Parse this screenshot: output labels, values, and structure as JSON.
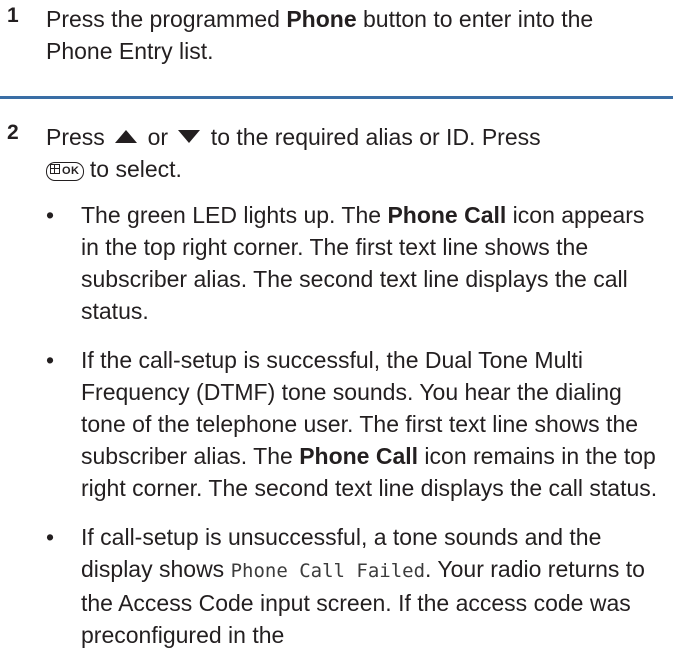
{
  "step1": {
    "number": "1",
    "text_before": "Press the programmed ",
    "bold": "Phone",
    "text_after": " button to enter into the Phone Entry list."
  },
  "step2": {
    "number": "2",
    "text_press": "Press ",
    "text_or": " or ",
    "text_after_arrows": " to the required alias or ID. Press",
    "ok_key_label": "OK",
    "text_select": " to select.",
    "bullets": [
      {
        "p1": "The green LED lights up. The ",
        "b1": "Phone Call",
        "p2": " icon appears in the top right corner. The first text line shows the subscriber alias. The second text line displays the call status."
      },
      {
        "p1": "If the call-setup is successful, the Dual Tone Multi Frequency (DTMF) tone sounds. You hear the dialing tone of the telephone user. The first text line shows the subscriber alias. The ",
        "b1": "Phone Call",
        "p2": " icon remains in the top right corner. The second text line displays the call status."
      },
      {
        "p1": "If call-setup is unsuccessful, a tone sounds and the display shows ",
        "mono": "Phone Call Failed",
        "p2": ". Your radio returns to the Access Code input screen. If the access code was preconfigured in the"
      }
    ]
  }
}
